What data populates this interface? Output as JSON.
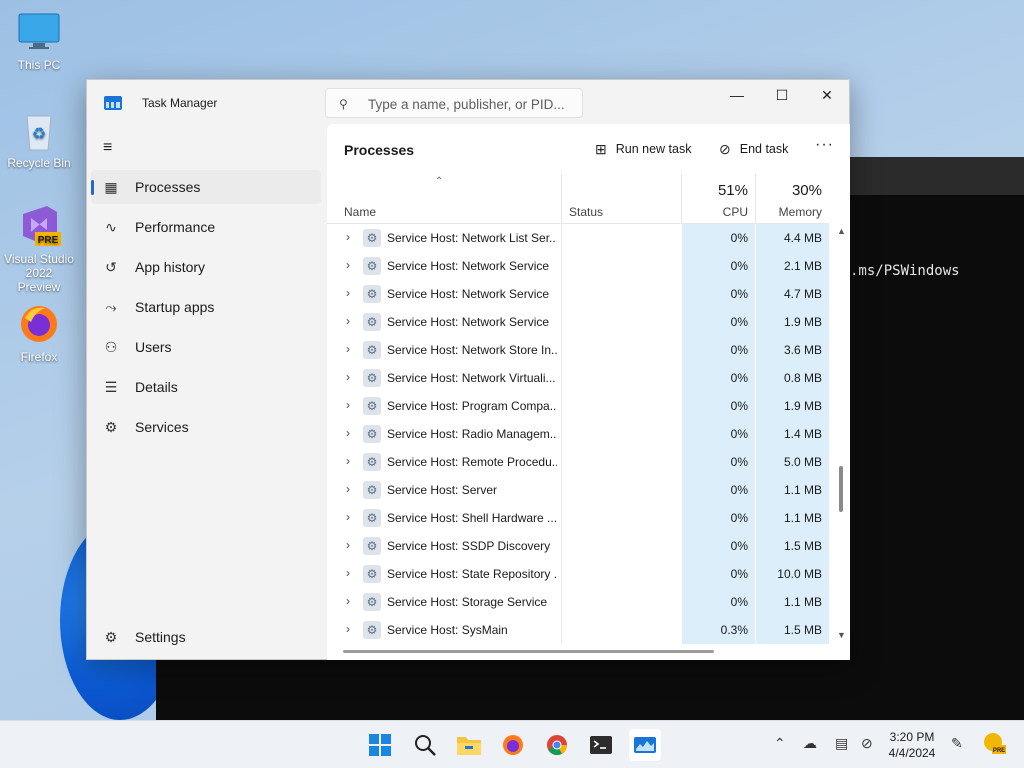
{
  "desktop": {
    "icons": [
      {
        "label": "This PC"
      },
      {
        "label": "Recycle Bin"
      },
      {
        "label": "Visual Studio 2022 Preview",
        "line1": "Visual Studio",
        "line2": "2022 Preview",
        "badge": "PRE"
      },
      {
        "label": "Firefox"
      }
    ],
    "terminal_text": ".ms/PSWindows"
  },
  "window": {
    "title": "Task Manager",
    "search_placeholder": "Type a name, publisher, or PID...",
    "controls": {
      "minimize": "—",
      "maximize": "☐",
      "close": "✕"
    }
  },
  "sidebar": {
    "items": [
      {
        "label": "Processes",
        "icon": "processes-icon",
        "active": true
      },
      {
        "label": "Performance",
        "icon": "performance-icon"
      },
      {
        "label": "App history",
        "icon": "app-history-icon"
      },
      {
        "label": "Startup apps",
        "icon": "startup-apps-icon"
      },
      {
        "label": "Users",
        "icon": "users-icon"
      },
      {
        "label": "Details",
        "icon": "details-icon"
      },
      {
        "label": "Services",
        "icon": "services-icon"
      }
    ],
    "settings_label": "Settings"
  },
  "content": {
    "title": "Processes",
    "run_new_task": "Run new task",
    "end_task": "End task",
    "columns": {
      "name": "Name",
      "status": "Status",
      "cpu_pct": "51%",
      "cpu": "CPU",
      "memory_pct": "30%",
      "memory": "Memory"
    },
    "rows": [
      {
        "name": "Service Host: Network List Ser...",
        "cpu": "0%",
        "memory": "4.4 MB"
      },
      {
        "name": "Service Host: Network Service",
        "cpu": "0%",
        "memory": "2.1 MB"
      },
      {
        "name": "Service Host: Network Service",
        "cpu": "0%",
        "memory": "4.7 MB"
      },
      {
        "name": "Service Host: Network Service",
        "cpu": "0%",
        "memory": "1.9 MB"
      },
      {
        "name": "Service Host: Network Store In...",
        "cpu": "0%",
        "memory": "3.6 MB"
      },
      {
        "name": "Service Host: Network Virtuali...",
        "cpu": "0%",
        "memory": "0.8 MB"
      },
      {
        "name": "Service Host: Program Compa...",
        "cpu": "0%",
        "memory": "1.9 MB"
      },
      {
        "name": "Service Host: Radio Managem...",
        "cpu": "0%",
        "memory": "1.4 MB"
      },
      {
        "name": "Service Host: Remote Procedu...",
        "cpu": "0%",
        "memory": "5.0 MB"
      },
      {
        "name": "Service Host: Server",
        "cpu": "0%",
        "memory": "1.1 MB"
      },
      {
        "name": "Service Host: Shell Hardware ...",
        "cpu": "0%",
        "memory": "1.1 MB"
      },
      {
        "name": "Service Host: SSDP Discovery",
        "cpu": "0%",
        "memory": "1.5 MB"
      },
      {
        "name": "Service Host: State Repository ...",
        "cpu": "0%",
        "memory": "10.0 MB"
      },
      {
        "name": "Service Host: Storage Service",
        "cpu": "0%",
        "memory": "1.1 MB"
      },
      {
        "name": "Service Host: SysMain",
        "cpu": "0.3%",
        "memory": "1.5 MB"
      }
    ]
  },
  "taskbar": {
    "time": "3:20 PM",
    "date": "4/4/2024",
    "pinned": [
      "start-icon",
      "search-icon",
      "file-explorer-icon",
      "firefox-icon",
      "chrome-icon",
      "terminal-icon",
      "task-manager-icon"
    ]
  },
  "colors": {
    "accent": "#2467c9",
    "heat": "#dbeefa",
    "taskbar": "#eef2f7"
  }
}
